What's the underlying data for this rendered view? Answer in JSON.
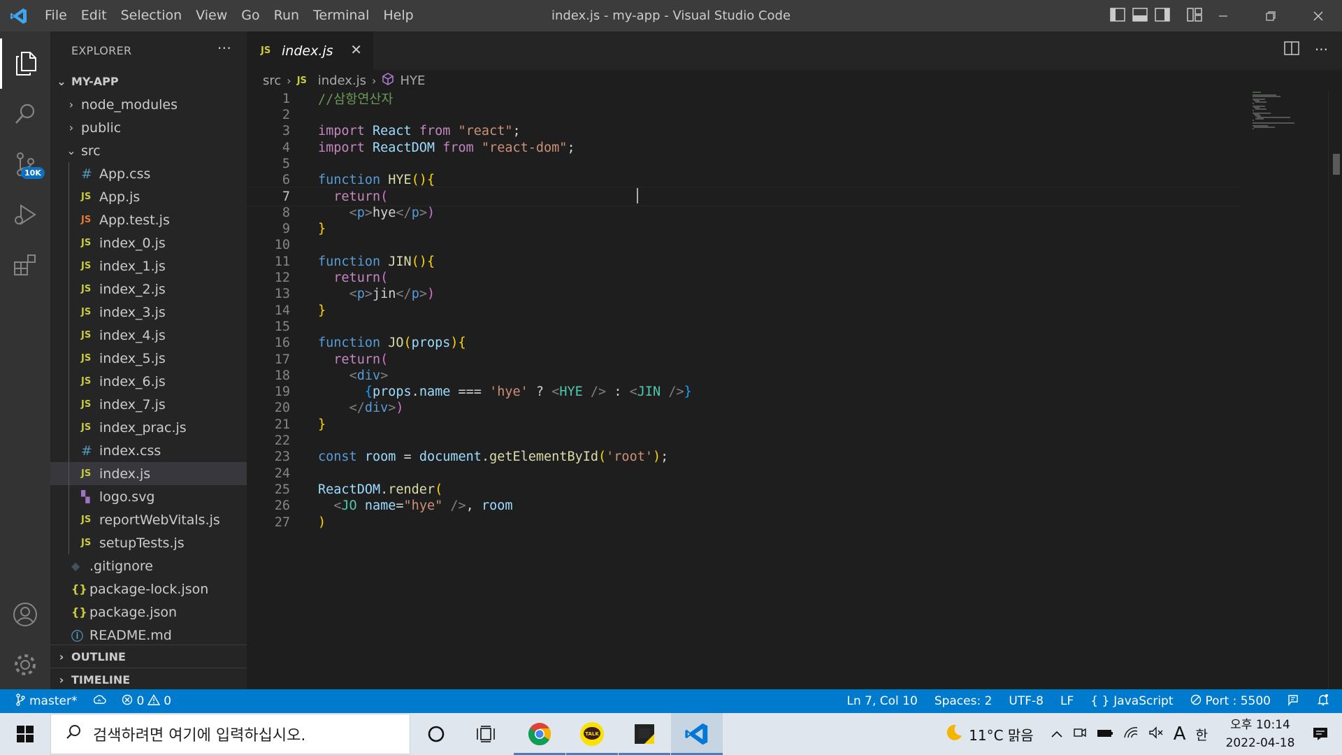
{
  "window": {
    "title": "index.js - my-app - Visual Studio Code",
    "menu": [
      "File",
      "Edit",
      "Selection",
      "View",
      "Go",
      "Run",
      "Terminal",
      "Help"
    ]
  },
  "activity": {
    "scm_badge": "10K"
  },
  "sidebar": {
    "title": "EXPLORER",
    "root": "MY-APP",
    "items": [
      {
        "label": "node_modules",
        "type": "folder",
        "depth": 1,
        "expanded": false
      },
      {
        "label": "public",
        "type": "folder",
        "depth": 1,
        "expanded": false
      },
      {
        "label": "src",
        "type": "folder",
        "depth": 1,
        "expanded": true
      },
      {
        "label": "App.css",
        "type": "css",
        "depth": 2
      },
      {
        "label": "App.js",
        "type": "js",
        "depth": 2
      },
      {
        "label": "App.test.js",
        "type": "jstest",
        "depth": 2
      },
      {
        "label": "index_0.js",
        "type": "js",
        "depth": 2
      },
      {
        "label": "index_1.js",
        "type": "js",
        "depth": 2
      },
      {
        "label": "index_2.js",
        "type": "js",
        "depth": 2
      },
      {
        "label": "index_3.js",
        "type": "js",
        "depth": 2
      },
      {
        "label": "index_4.js",
        "type": "js",
        "depth": 2
      },
      {
        "label": "index_5.js",
        "type": "js",
        "depth": 2
      },
      {
        "label": "index_6.js",
        "type": "js",
        "depth": 2
      },
      {
        "label": "index_7.js",
        "type": "js",
        "depth": 2
      },
      {
        "label": "index_prac.js",
        "type": "js",
        "depth": 2
      },
      {
        "label": "index.css",
        "type": "css",
        "depth": 2
      },
      {
        "label": "index.js",
        "type": "js",
        "depth": 2,
        "selected": true
      },
      {
        "label": "logo.svg",
        "type": "svg",
        "depth": 2
      },
      {
        "label": "reportWebVitals.js",
        "type": "js",
        "depth": 2
      },
      {
        "label": "setupTests.js",
        "type": "js",
        "depth": 2
      },
      {
        "label": ".gitignore",
        "type": "git",
        "depth": 1
      },
      {
        "label": "package-lock.json",
        "type": "json",
        "depth": 1
      },
      {
        "label": "package.json",
        "type": "json",
        "depth": 1
      },
      {
        "label": "README.md",
        "type": "md",
        "depth": 1
      }
    ],
    "outline": "OUTLINE",
    "timeline": "TIMELINE"
  },
  "editor": {
    "tab": {
      "icon": "JS",
      "label": "index.js"
    },
    "breadcrumb": {
      "folder": "src",
      "file_icon": "JS",
      "file": "index.js",
      "symbol": "HYE"
    },
    "current_line": 7,
    "lines": [
      [
        [
          "c",
          "//삼항연산자"
        ]
      ],
      [],
      [
        [
          "k",
          "import"
        ],
        [
          "t",
          " "
        ],
        [
          "v",
          "React"
        ],
        [
          "t",
          " "
        ],
        [
          "k",
          "from"
        ],
        [
          "t",
          " "
        ],
        [
          "s",
          "\"react\""
        ],
        [
          "t",
          ";"
        ]
      ],
      [
        [
          "k",
          "import"
        ],
        [
          "t",
          " "
        ],
        [
          "v",
          "ReactDOM"
        ],
        [
          "t",
          " "
        ],
        [
          "k",
          "from"
        ],
        [
          "t",
          " "
        ],
        [
          "s",
          "\"react-dom\""
        ],
        [
          "t",
          ";"
        ]
      ],
      [],
      [
        [
          "b",
          "function"
        ],
        [
          "t",
          " "
        ],
        [
          "f",
          "HYE"
        ],
        [
          "y",
          "()"
        ],
        [
          "y",
          "{"
        ]
      ],
      [
        [
          "t",
          "  "
        ],
        [
          "k",
          "return"
        ],
        [
          "p",
          "("
        ]
      ],
      [
        [
          "t",
          "    "
        ],
        [
          "g",
          "<"
        ],
        [
          "n",
          "p"
        ],
        [
          "g",
          ">"
        ],
        [
          "t",
          "hye"
        ],
        [
          "g",
          "</"
        ],
        [
          "n",
          "p"
        ],
        [
          "g",
          ">"
        ],
        [
          "p",
          ")"
        ]
      ],
      [
        [
          "y",
          "}"
        ]
      ],
      [],
      [
        [
          "b",
          "function"
        ],
        [
          "t",
          " "
        ],
        [
          "f",
          "JIN"
        ],
        [
          "y",
          "()"
        ],
        [
          "y",
          "{"
        ]
      ],
      [
        [
          "t",
          "  "
        ],
        [
          "k",
          "return"
        ],
        [
          "p",
          "("
        ]
      ],
      [
        [
          "t",
          "    "
        ],
        [
          "g",
          "<"
        ],
        [
          "n",
          "p"
        ],
        [
          "g",
          ">"
        ],
        [
          "t",
          "jin"
        ],
        [
          "g",
          "</"
        ],
        [
          "n",
          "p"
        ],
        [
          "g",
          ">"
        ],
        [
          "p",
          ")"
        ]
      ],
      [
        [
          "y",
          "}"
        ]
      ],
      [],
      [
        [
          "b",
          "function"
        ],
        [
          "t",
          " "
        ],
        [
          "f",
          "JO"
        ],
        [
          "y",
          "("
        ],
        [
          "v",
          "props"
        ],
        [
          "y",
          ")"
        ],
        [
          "y",
          "{"
        ]
      ],
      [
        [
          "t",
          "  "
        ],
        [
          "k",
          "return"
        ],
        [
          "p",
          "("
        ]
      ],
      [
        [
          "t",
          "    "
        ],
        [
          "g",
          "<"
        ],
        [
          "n",
          "div"
        ],
        [
          "g",
          ">"
        ]
      ],
      [
        [
          "t",
          "      "
        ],
        [
          "q",
          "{"
        ],
        [
          "v",
          "props"
        ],
        [
          "t",
          "."
        ],
        [
          "v",
          "name"
        ],
        [
          "t",
          " === "
        ],
        [
          "s",
          "'hye'"
        ],
        [
          "t",
          " ? "
        ],
        [
          "g",
          "<"
        ],
        [
          "h",
          "HYE"
        ],
        [
          "t",
          " "
        ],
        [
          "g",
          "/>"
        ],
        [
          "t",
          " : "
        ],
        [
          "g",
          "<"
        ],
        [
          "h",
          "JIN"
        ],
        [
          "t",
          " "
        ],
        [
          "g",
          "/>"
        ],
        [
          "q",
          "}"
        ]
      ],
      [
        [
          "t",
          "    "
        ],
        [
          "g",
          "</"
        ],
        [
          "n",
          "div"
        ],
        [
          "g",
          ">"
        ],
        [
          "p",
          ")"
        ]
      ],
      [
        [
          "y",
          "}"
        ]
      ],
      [],
      [
        [
          "b",
          "const"
        ],
        [
          "t",
          " "
        ],
        [
          "w",
          "room"
        ],
        [
          "t",
          " = "
        ],
        [
          "v",
          "document"
        ],
        [
          "t",
          "."
        ],
        [
          "f",
          "getElementById"
        ],
        [
          "y",
          "("
        ],
        [
          "s",
          "'root'"
        ],
        [
          "y",
          ")"
        ],
        [
          "t",
          ";"
        ]
      ],
      [],
      [
        [
          "v",
          "ReactDOM"
        ],
        [
          "t",
          "."
        ],
        [
          "f",
          "render"
        ],
        [
          "y",
          "("
        ]
      ],
      [
        [
          "t",
          "  "
        ],
        [
          "g",
          "<"
        ],
        [
          "h",
          "JO"
        ],
        [
          "t",
          " "
        ],
        [
          "v",
          "name"
        ],
        [
          "t",
          "="
        ],
        [
          "s",
          "\"hye\""
        ],
        [
          "t",
          " "
        ],
        [
          "g",
          "/>"
        ],
        [
          "t",
          ", "
        ],
        [
          "w",
          "room"
        ]
      ],
      [
        [
          "y",
          ")"
        ]
      ]
    ]
  },
  "statusbar": {
    "branch": "master*",
    "errors": "0",
    "warnings": "0",
    "position": "Ln 7, Col 10",
    "spaces": "Spaces: 2",
    "encoding": "UTF-8",
    "eol": "LF",
    "language": "JavaScript",
    "port": "Port : 5500"
  },
  "taskbar": {
    "search_placeholder": "검색하려면 여기에 입력하십시오.",
    "kakao_label": "TALK",
    "weather": "11°C  맑음",
    "ime_a": "A",
    "ime_han": "한",
    "time": "오후 10:14",
    "date": "2022-04-18"
  }
}
